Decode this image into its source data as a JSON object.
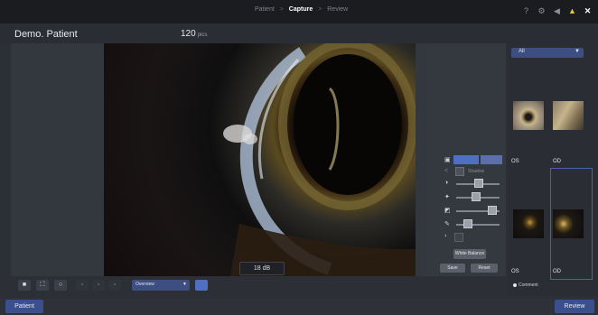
{
  "breadcrumbs": {
    "patient": "Patient",
    "sep1": ">",
    "capture": "Capture",
    "sep2": ">",
    "review": "Review"
  },
  "top_icons": [
    "help-icon",
    "gear-icon",
    "back-icon",
    "warning-icon",
    "close-icon"
  ],
  "patient": {
    "name": "Demo. Patient",
    "count": "120",
    "count_unit": "pics"
  },
  "image": {
    "gain": "18 dB"
  },
  "controls": {
    "white_balance": "White Balance",
    "save": "Save",
    "reset": "Reset",
    "setting_label": "Shadow",
    "step1": "1",
    "step2": "2"
  },
  "thumbnails": {
    "filter": "All",
    "labels": [
      "OS",
      "OD",
      "OS",
      "OD"
    ],
    "comment": "Comment"
  },
  "toolbar": {
    "mode": "Overview"
  },
  "nav": {
    "left": "Patient",
    "right": "Review"
  }
}
